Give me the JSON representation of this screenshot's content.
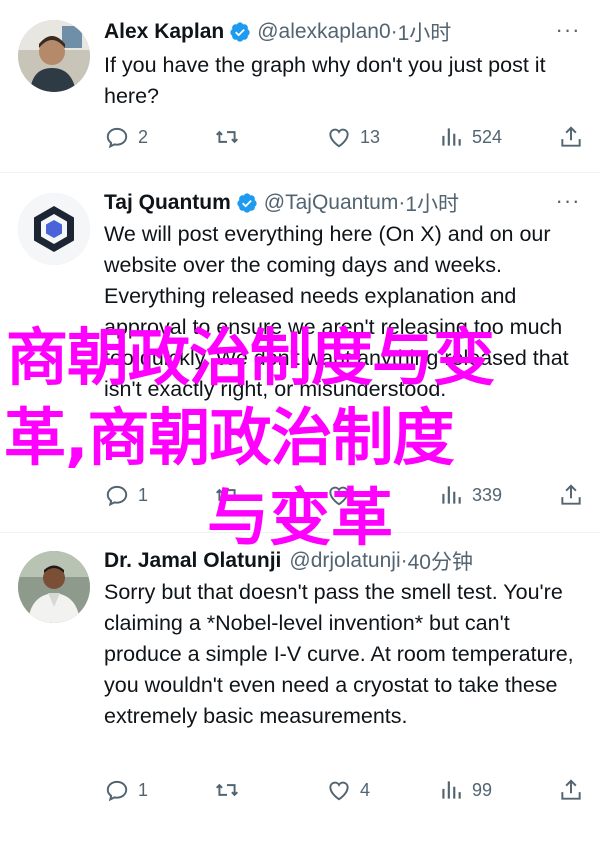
{
  "tweets": [
    {
      "author": "Alex Kaplan",
      "handle": "@alexkaplan0",
      "time": "1小时",
      "text": "If you have the graph why don't you just post it here?",
      "replies": "2",
      "retweets": "",
      "likes": "13",
      "views": "524"
    },
    {
      "author": "Taj Quantum",
      "handle": "@TajQuantum",
      "time": "1小时",
      "text": "We will post everything here (On X) and on our website over the coming days and weeks. Everything released needs explanation and approval to ensure we aren't releasing too much too quickly. We don't want anything released that isn't exactly right, or misunderstood.",
      "replies": "1",
      "retweets": "",
      "likes": "",
      "views": "339"
    },
    {
      "author": "Dr. Jamal Olatunji",
      "handle": "@drjolatunji",
      "time": "40分钟",
      "text": "Sorry but that doesn't pass the smell test. You're claiming a *Nobel-level invention* but can't produce a simple I-V curve. At room temperature, you wouldn't even need a cryostat to take these extremely basic measurements.",
      "replies": "1",
      "retweets": "",
      "likes": "4",
      "views": "99"
    }
  ],
  "overlay": {
    "line1": "商朝政治制度与变",
    "line2": "革,商朝政治制度",
    "line3": "与变革"
  },
  "colors": {
    "verified": "#1d9bf0",
    "overlay": "#ff00ff",
    "muted": "#536471"
  },
  "icons": [
    "reply-icon",
    "retweet-icon",
    "like-icon",
    "views-icon",
    "share-icon",
    "more-icon",
    "verified-badge-icon"
  ]
}
